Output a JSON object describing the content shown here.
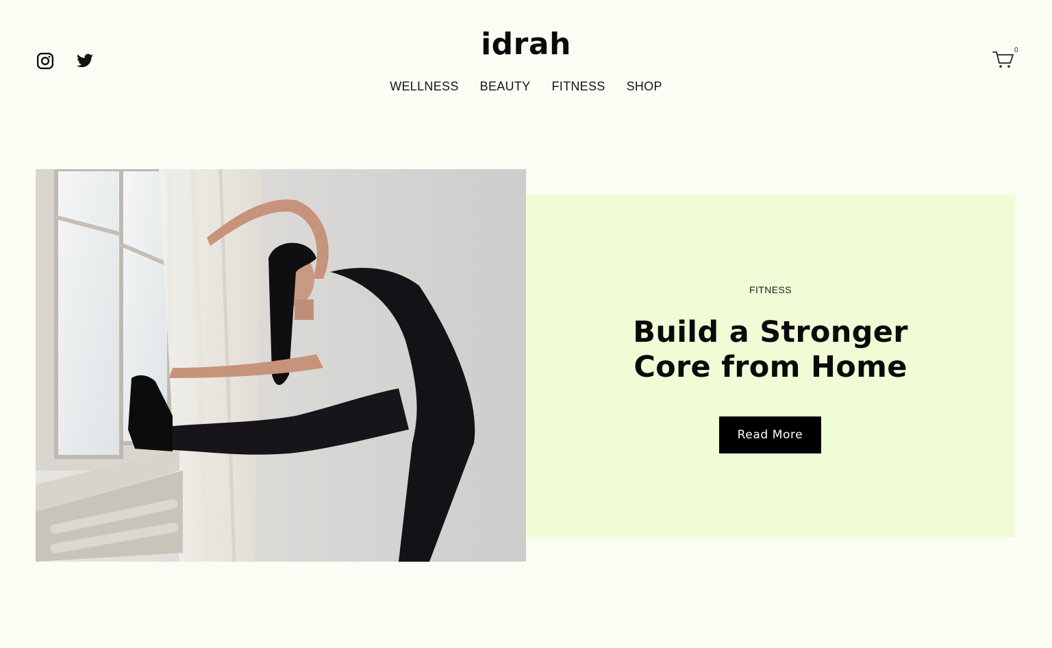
{
  "header": {
    "brand": "idrah",
    "social": [
      {
        "icon": "instagram-icon"
      },
      {
        "icon": "twitter-icon"
      }
    ],
    "nav": [
      {
        "label": "WELLNESS"
      },
      {
        "label": "BEAUTY"
      },
      {
        "label": "FITNESS"
      },
      {
        "label": "SHOP"
      }
    ],
    "cart": {
      "icon": "cart-icon",
      "count": "0"
    }
  },
  "hero": {
    "category": "FITNESS",
    "title_line1": "Build a Stronger",
    "title_line2": "Core from Home",
    "button_label": "Read More",
    "card_color": "#f0fcd6"
  },
  "colors": {
    "background": "#fbfdf5",
    "text": "#111111",
    "button": "#000000"
  }
}
